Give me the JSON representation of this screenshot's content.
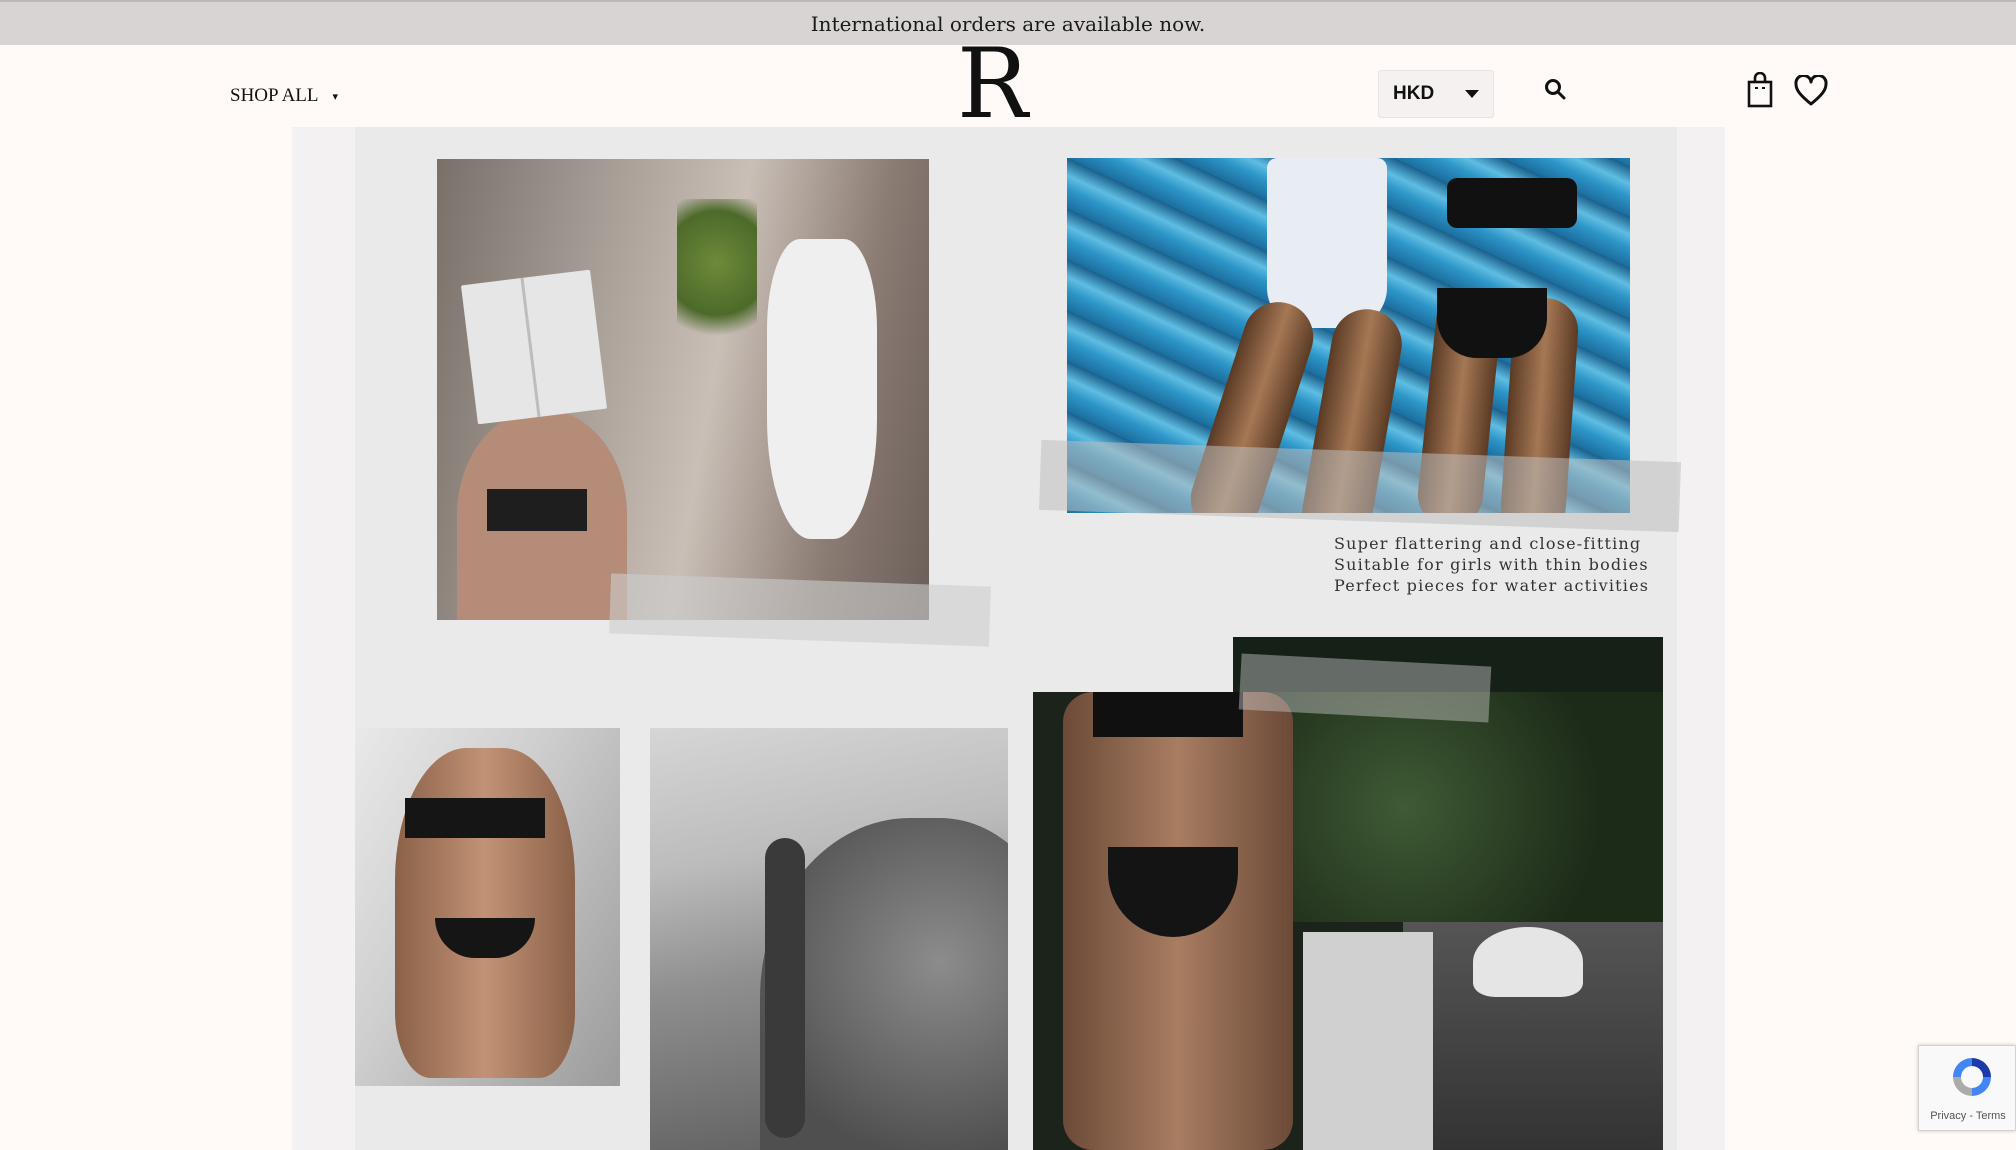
{
  "announcement": {
    "text": "International orders are available now."
  },
  "header": {
    "shop_all_label": "SHOP ALL",
    "caret": "▾",
    "logo_letter": "R",
    "currency": "HKD"
  },
  "icons": {
    "search": "search-icon",
    "bag": "shopping-bag-icon",
    "wishlist": "heart-icon"
  },
  "collage": {
    "caption_lines": [
      "Super flattering and close-fitting",
      "Suitable for girls with thin bodies",
      "Perfect pieces for water activities"
    ]
  },
  "recaptcha": {
    "privacy": "Privacy",
    "separator": " - ",
    "terms": "Terms"
  },
  "colors": {
    "announcement_bg": "#d8d4d4",
    "page_bg": "#fffaf8",
    "text": "#111111"
  }
}
